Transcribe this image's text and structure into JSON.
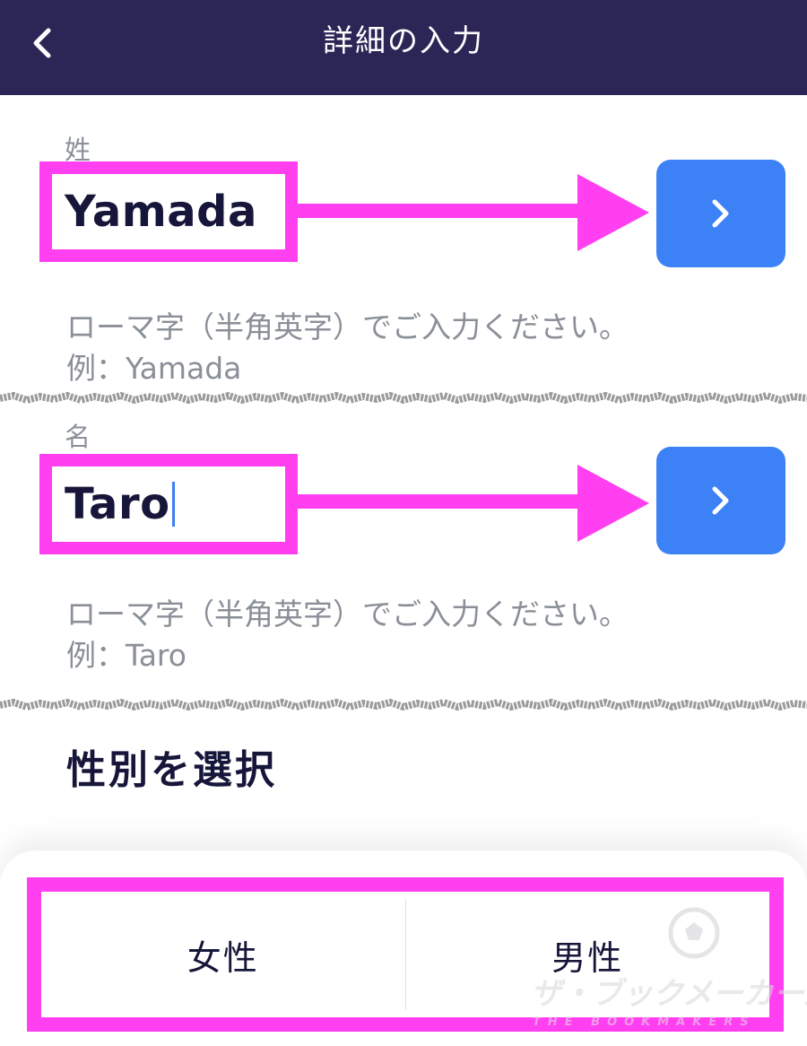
{
  "header": {
    "title": "詳細の入力",
    "back_icon": "chevron-left-icon"
  },
  "last_name": {
    "label": "姓",
    "value": "Yamada",
    "hint_line1": "ローマ字（半角英字）でご入力ください。",
    "hint_line2": "例：Yamada"
  },
  "first_name": {
    "label": "名",
    "value": "Taro",
    "hint_line1": "ローマ字（半角英字）でご入力ください。",
    "hint_line2": "例：Taro"
  },
  "next_button_icon": "chevron-right-icon",
  "gender": {
    "title": "性別を選択",
    "options": [
      "女性",
      "男性"
    ]
  },
  "watermark": {
    "text": "ザ・ブックメーカーズ",
    "subtext": "THE BOOKMAKERS"
  },
  "colors": {
    "header_bg": "#2c2657",
    "accent_blue": "#3c82f6",
    "highlight_magenta": "#ff3ff0",
    "hint_gray": "#8a8f98",
    "text_dark": "#16163a"
  }
}
